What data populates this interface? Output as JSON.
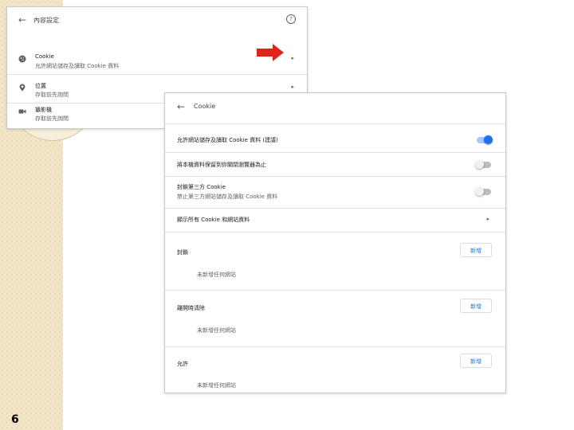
{
  "slide": {
    "number": "6"
  },
  "content_settings": {
    "title": "內容設定",
    "rows": [
      {
        "icon": "cookie-icon",
        "title": "Cookie",
        "subtitle": "允許網站儲存及讀取 Cookie 資料"
      },
      {
        "icon": "location-icon",
        "title": "位置",
        "subtitle": "存取前先詢問"
      },
      {
        "icon": "camera-icon",
        "title": "攝影機",
        "subtitle": "存取前先詢問"
      }
    ]
  },
  "cookie_panel": {
    "title": "Cookie",
    "settings": [
      {
        "label": "允許網站儲存及讀取 Cookie 資料 (建議)",
        "toggle": true
      },
      {
        "label": "將本機資料保留到你關閉瀏覽器為止",
        "toggle": false
      },
      {
        "label": "封鎖第三方 Cookie",
        "sublabel": "禁止第三方網站儲存及讀取 Cookie 資料",
        "toggle": false
      },
      {
        "label": "顯示所有 Cookie 和網站資料"
      }
    ],
    "sections": [
      {
        "label": "封鎖",
        "button": "新增",
        "empty": "未新增任何網站"
      },
      {
        "label": "離開時清除",
        "button": "新增",
        "empty": "未新增任何網站"
      },
      {
        "label": "允許",
        "button": "新增",
        "empty": "未新增任何網站"
      }
    ]
  },
  "colors": {
    "accent": "#1a73e8",
    "arrow": "#e0241b"
  }
}
